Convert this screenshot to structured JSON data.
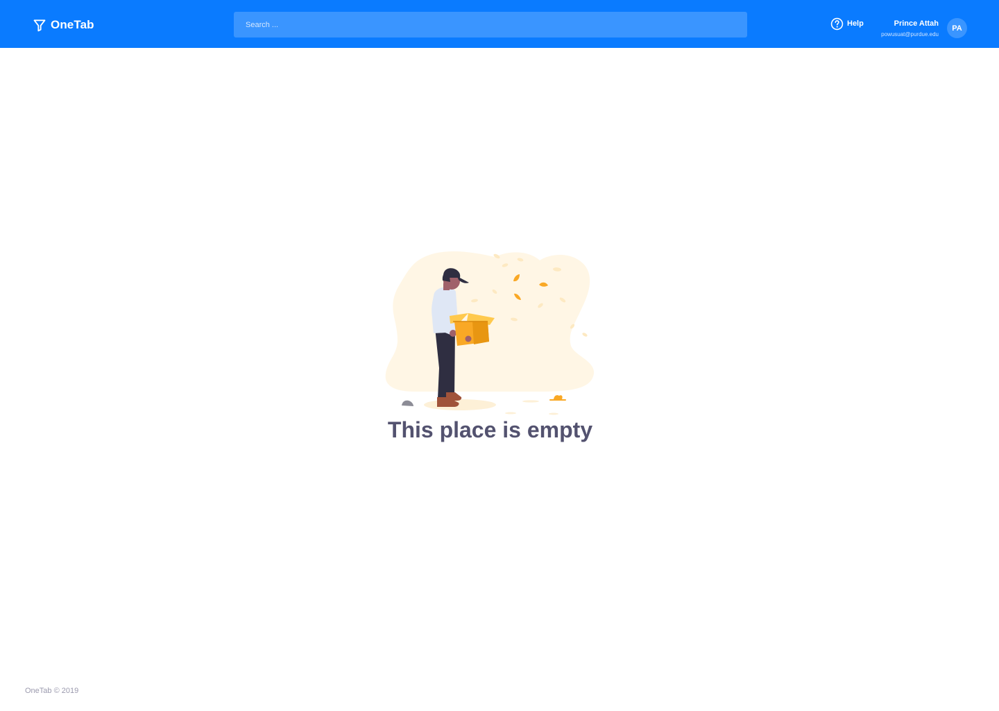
{
  "header": {
    "brand": {
      "name": "OneTab",
      "icon": "funnel-icon"
    },
    "search": {
      "placeholder": "Search ..."
    },
    "help": {
      "label": "Help",
      "icon": "question-circle-icon"
    },
    "user": {
      "name": "Prince Attah",
      "email": "powusuat@purdue.edu",
      "initials": "PA"
    }
  },
  "main": {
    "empty_state": {
      "illustration": "person-holding-empty-box-illustration",
      "title": "This place is empty"
    }
  },
  "footer": {
    "copyright": "OneTab © 2019"
  },
  "colors": {
    "header_bg": "#0a7bff",
    "search_bg": "#3a95ff",
    "title_text": "#53526f",
    "footer_text": "#9a99ad",
    "accent_box": "#f9a825"
  }
}
